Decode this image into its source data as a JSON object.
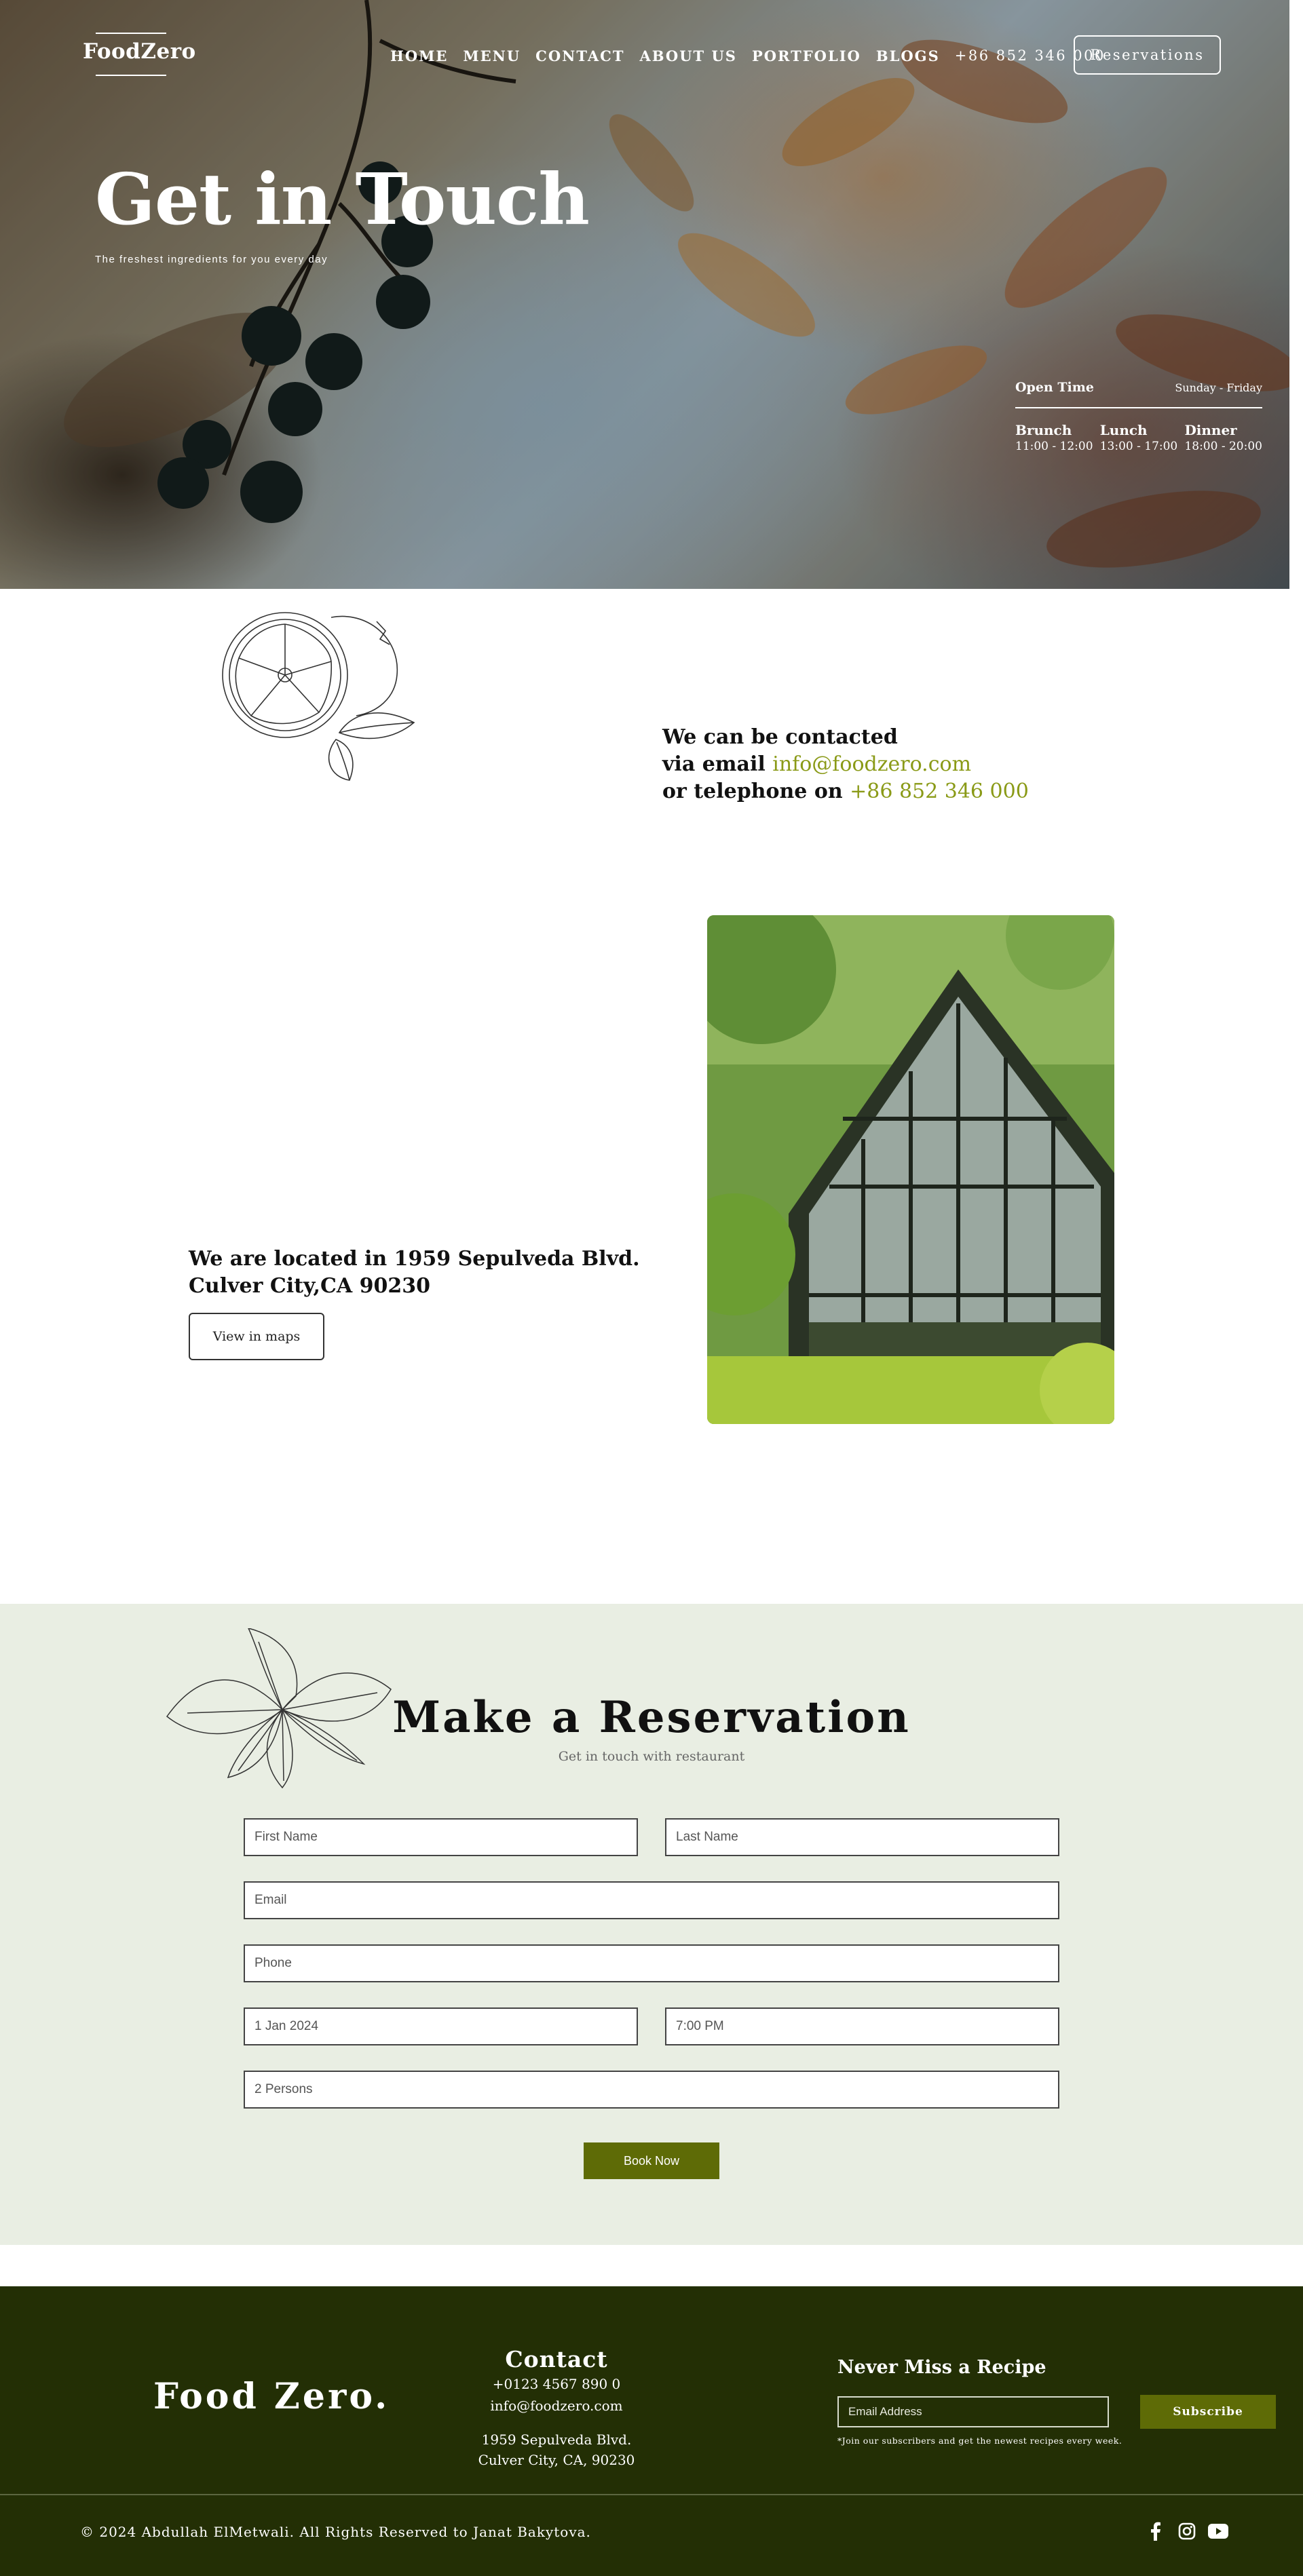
{
  "header": {
    "logo": "FoodZero",
    "nav": [
      "HOME",
      "MENU",
      "CONTACT",
      "ABOUT US",
      "PORTFOLIO",
      "BLOGS"
    ],
    "phone": "+86 852 346 000",
    "reservations_label": "Reservations"
  },
  "hero": {
    "title": "Get in Touch",
    "subtitle": "The freshest ingredients for you every day",
    "hours": {
      "title": "Open Time",
      "days": "Sunday - Friday",
      "meals": [
        {
          "label": "Brunch",
          "time": "11:00 - 12:00"
        },
        {
          "label": "Lunch",
          "time": "13:00 - 17:00"
        },
        {
          "label": "Dinner",
          "time": "18:00 - 20:00"
        }
      ]
    }
  },
  "contact": {
    "line1": "We can be contacted",
    "line2_prefix": "via email ",
    "email": "info@foodzero.com",
    "line3_prefix": "or telephone on ",
    "phone": "+86 852 346 000"
  },
  "location": {
    "line1": "We are located in 1959 Sepulveda Blvd.",
    "line2": "Culver City,CA 90230",
    "maps_button": "View in maps"
  },
  "reservation": {
    "title": "Make a Reservation",
    "subtitle": "Get in touch with restaurant",
    "fields": {
      "first_name": "First Name",
      "last_name": "Last Name",
      "email": "Email",
      "phone": "Phone",
      "date": "1 Jan 2024",
      "time": "7:00 PM",
      "persons": "2 Persons"
    },
    "book_button": "Book Now"
  },
  "footer": {
    "logo": "Food Zero.",
    "contact_title": "Contact",
    "contact_phone": "+0123 4567 890 0",
    "contact_email": "info@foodzero.com",
    "address_line1": "1959 Sepulveda Blvd.",
    "address_line2": "Culver City, CA, 90230",
    "newsletter_title": "Never Miss a Recipe",
    "email_placeholder": "Email Address",
    "subscribe_label": "Subscribe",
    "newsletter_note": "*Join our subscribers and get the newest recipes every week.",
    "copyright": "© 2024 Abdullah ElMetwali. All Rights Reserved to Janat Bakytova.",
    "socials": [
      "facebook-icon",
      "instagram-icon",
      "youtube-icon"
    ]
  },
  "colors": {
    "accent": "#8a9a17",
    "button_olive": "#5e6b06",
    "footer_bg": "#232f05",
    "reservation_bg": "#e9eee3"
  }
}
